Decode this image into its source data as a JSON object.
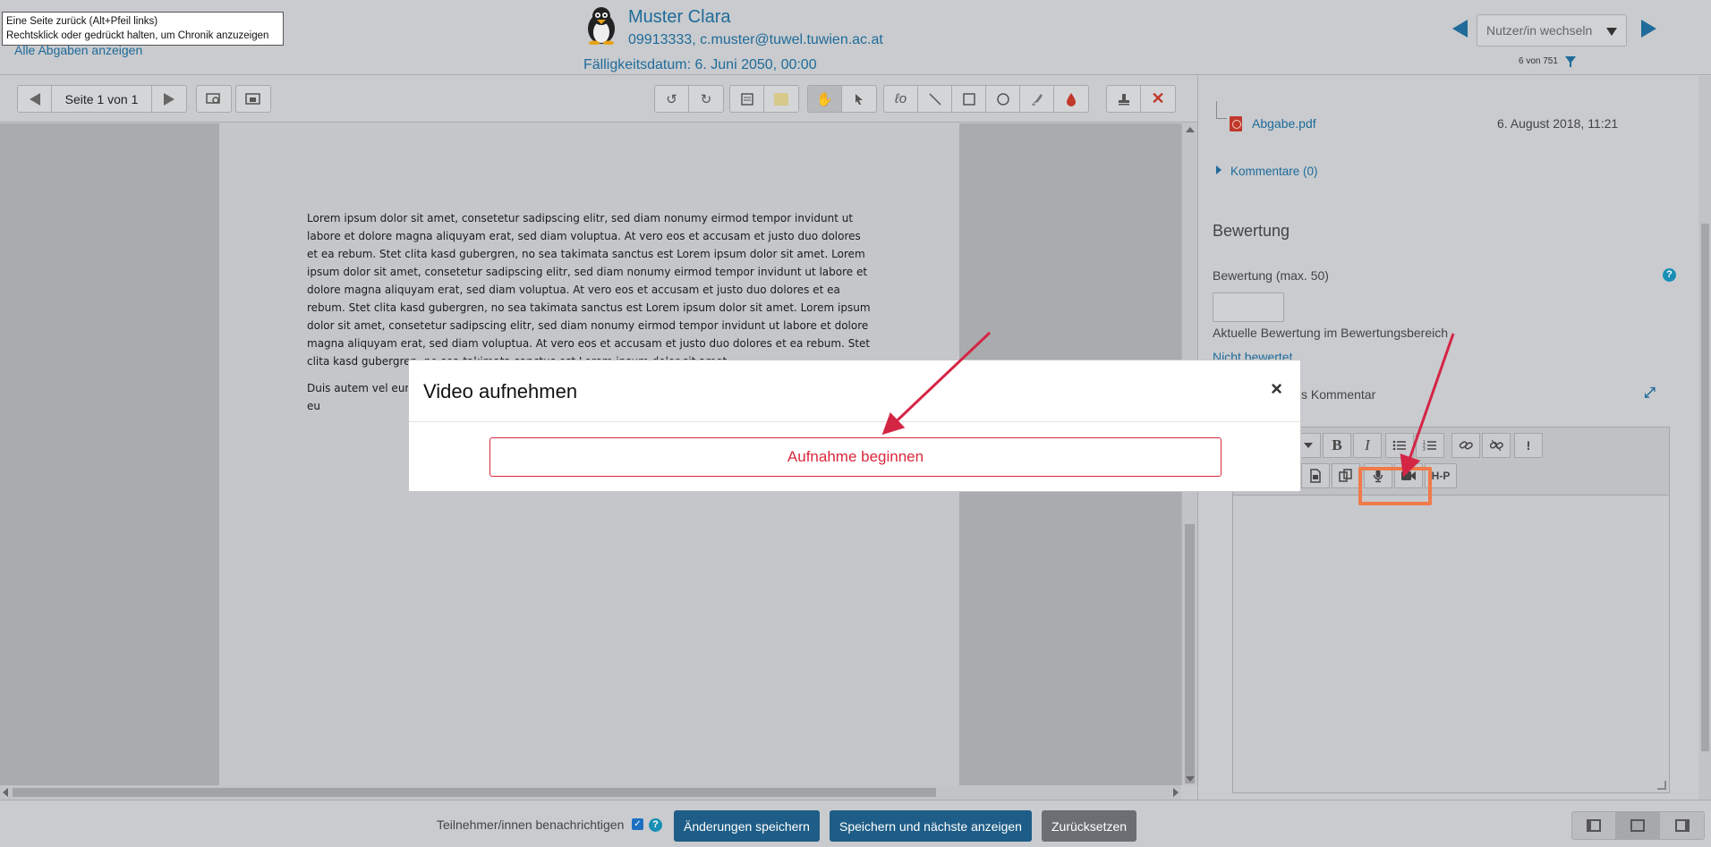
{
  "browser": {
    "tooltip_line1": "Eine Seite zurück (Alt+Pfeil links)",
    "tooltip_line2": "Rechtsklick oder gedrückt halten, um Chronik anzuzeigen"
  },
  "header": {
    "back_link": "Alle Abgaben anzeigen",
    "user_name": "Muster Clara",
    "user_id": "09913333, c.muster@tuwel.tuwien.ac.at",
    "due_date": "Fälligkeitsdatum: 6. Juni 2050, 00:00",
    "user_switch_placeholder": "Nutzer/in wechseln",
    "counter": "6 von 751"
  },
  "toolbar": {
    "page_label": "Seite 1 von 1"
  },
  "document": {
    "paragraph1": "Lorem ipsum dolor sit amet, consetetur sadipscing elitr, sed diam nonumy eirmod tempor invidunt ut labore et dolore magna aliquyam erat, sed diam voluptua. At vero eos et accusam et justo duo dolores et ea rebum. Stet clita kasd gubergren, no sea takimata sanctus est Lorem ipsum dolor sit amet. Lorem ipsum dolor sit amet, consetetur sadipscing elitr, sed diam nonumy eirmod tempor invidunt ut labore et dolore magna aliquyam erat, sed diam voluptua. At vero eos et accusam et justo duo dolores et ea rebum. Stet clita kasd gubergren, no sea takimata sanctus est Lorem ipsum dolor sit amet. Lorem ipsum dolor sit amet, consetetur sadipscing elitr, sed diam nonumy eirmod tempor invidunt ut labore et dolore magna aliquyam erat, sed diam voluptua. At vero eos et accusam et justo duo dolores et ea rebum. Stet clita kasd gubergren, no sea takimata sanctus est Lorem ipsum dolor sit amet.",
    "paragraph2": "Duis autem vel eum iriure dolor in hendrerit in vulputate velit esse molestie consequat, vel illum dolore eu"
  },
  "submission": {
    "file_name": "Abgabe.pdf",
    "file_date": "6. August 2018, 11:21",
    "comments_label": "Kommentare (0)"
  },
  "grading": {
    "section_title": "Bewertung",
    "grade_label": "Bewertung (max. 50)",
    "help_glyph": "?",
    "current_grade_label": "Aktuelle Bewertung im Bewertungsbereich",
    "current_grade_value": "Nicht bewertet",
    "feedback_label": "s Kommentar"
  },
  "editor": {
    "bold": "B",
    "italic": "I",
    "h5p": "H-P",
    "warn": "!"
  },
  "modal": {
    "title": "Video aufnehmen",
    "close": "×",
    "record_button": "Aufnahme beginnen"
  },
  "footer": {
    "notify_label": "Teilnehmer/innen benachrichtigen",
    "notify_checked": "✓",
    "help_glyph": "?",
    "save": "Änderungen speichern",
    "save_next": "Speichern und nächste anzeigen",
    "reset": "Zurücksetzen"
  },
  "colors": {
    "link": "#1f6b9a",
    "primary_button": "#1e5d87",
    "record_red": "#d9283d",
    "highlight": "#f07a4a",
    "arrow": "#d42545"
  },
  "icons": [
    "back-arrow-icon",
    "forward-arrow-icon",
    "filter-icon",
    "rotate-left-icon",
    "rotate-right-icon",
    "comment-icon",
    "highlight-icon",
    "pan-icon",
    "select-icon",
    "pen-icon",
    "line-icon",
    "rectangle-icon",
    "oval-icon",
    "stamp-icon",
    "color-icon",
    "delete-icon",
    "microphone-icon",
    "video-camera-icon",
    "link-icon",
    "unlink-icon",
    "expand-icon",
    "pdf-icon"
  ]
}
